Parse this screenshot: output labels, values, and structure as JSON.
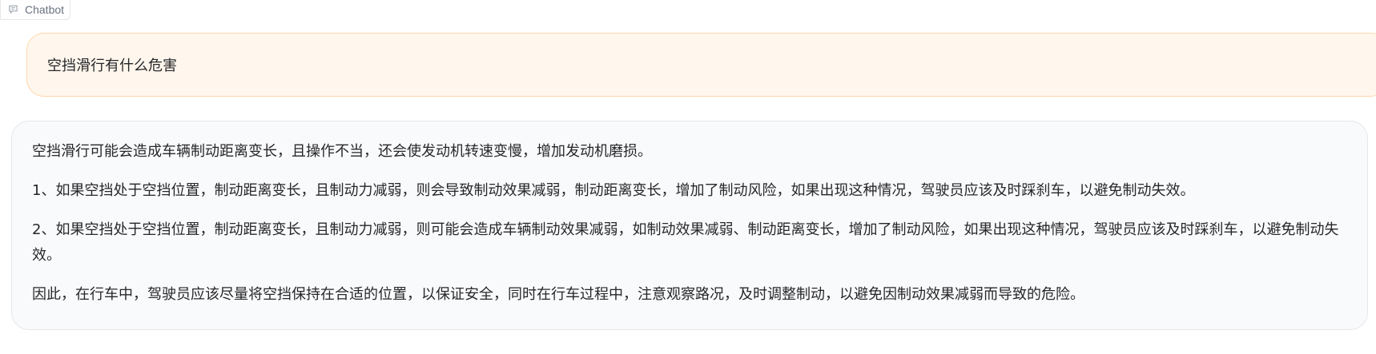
{
  "header": {
    "label": "Chatbot",
    "icon": "chat-bubble-icon"
  },
  "conversation": {
    "user_message": "空挡滑行有什么危害",
    "bot_paragraphs": [
      "空挡滑行可能会造成车辆制动距离变长，且操作不当，还会使发动机转速变慢，增加发动机磨损。",
      "1、如果空挡处于空挡位置，制动距离变长，且制动力减弱，则会导致制动效果减弱，制动距离变长，增加了制动风险，如果出现这种情况，驾驶员应该及时踩刹车，以避免制动失效。",
      "2、如果空挡处于空挡位置，制动距离变长，且制动力减弱，则可能会造成车辆制动效果减弱，如制动效果减弱、制动距离变长，增加了制动风险，如果出现这种情况，驾驶员应该及时踩刹车，以避免制动失效。",
      "因此，在行车中，驾驶员应该尽量将空挡保持在合适的位置，以保证安全，同时在行车过程中，注意观察路况，及时调整制动，以避免因制动效果减弱而导致的危险。"
    ]
  },
  "colors": {
    "user_bubble_bg": "#fff7ed",
    "user_bubble_border": "#fed7aa",
    "bot_bubble_bg": "#f9fafb",
    "bot_bubble_border": "#e5e7eb"
  }
}
